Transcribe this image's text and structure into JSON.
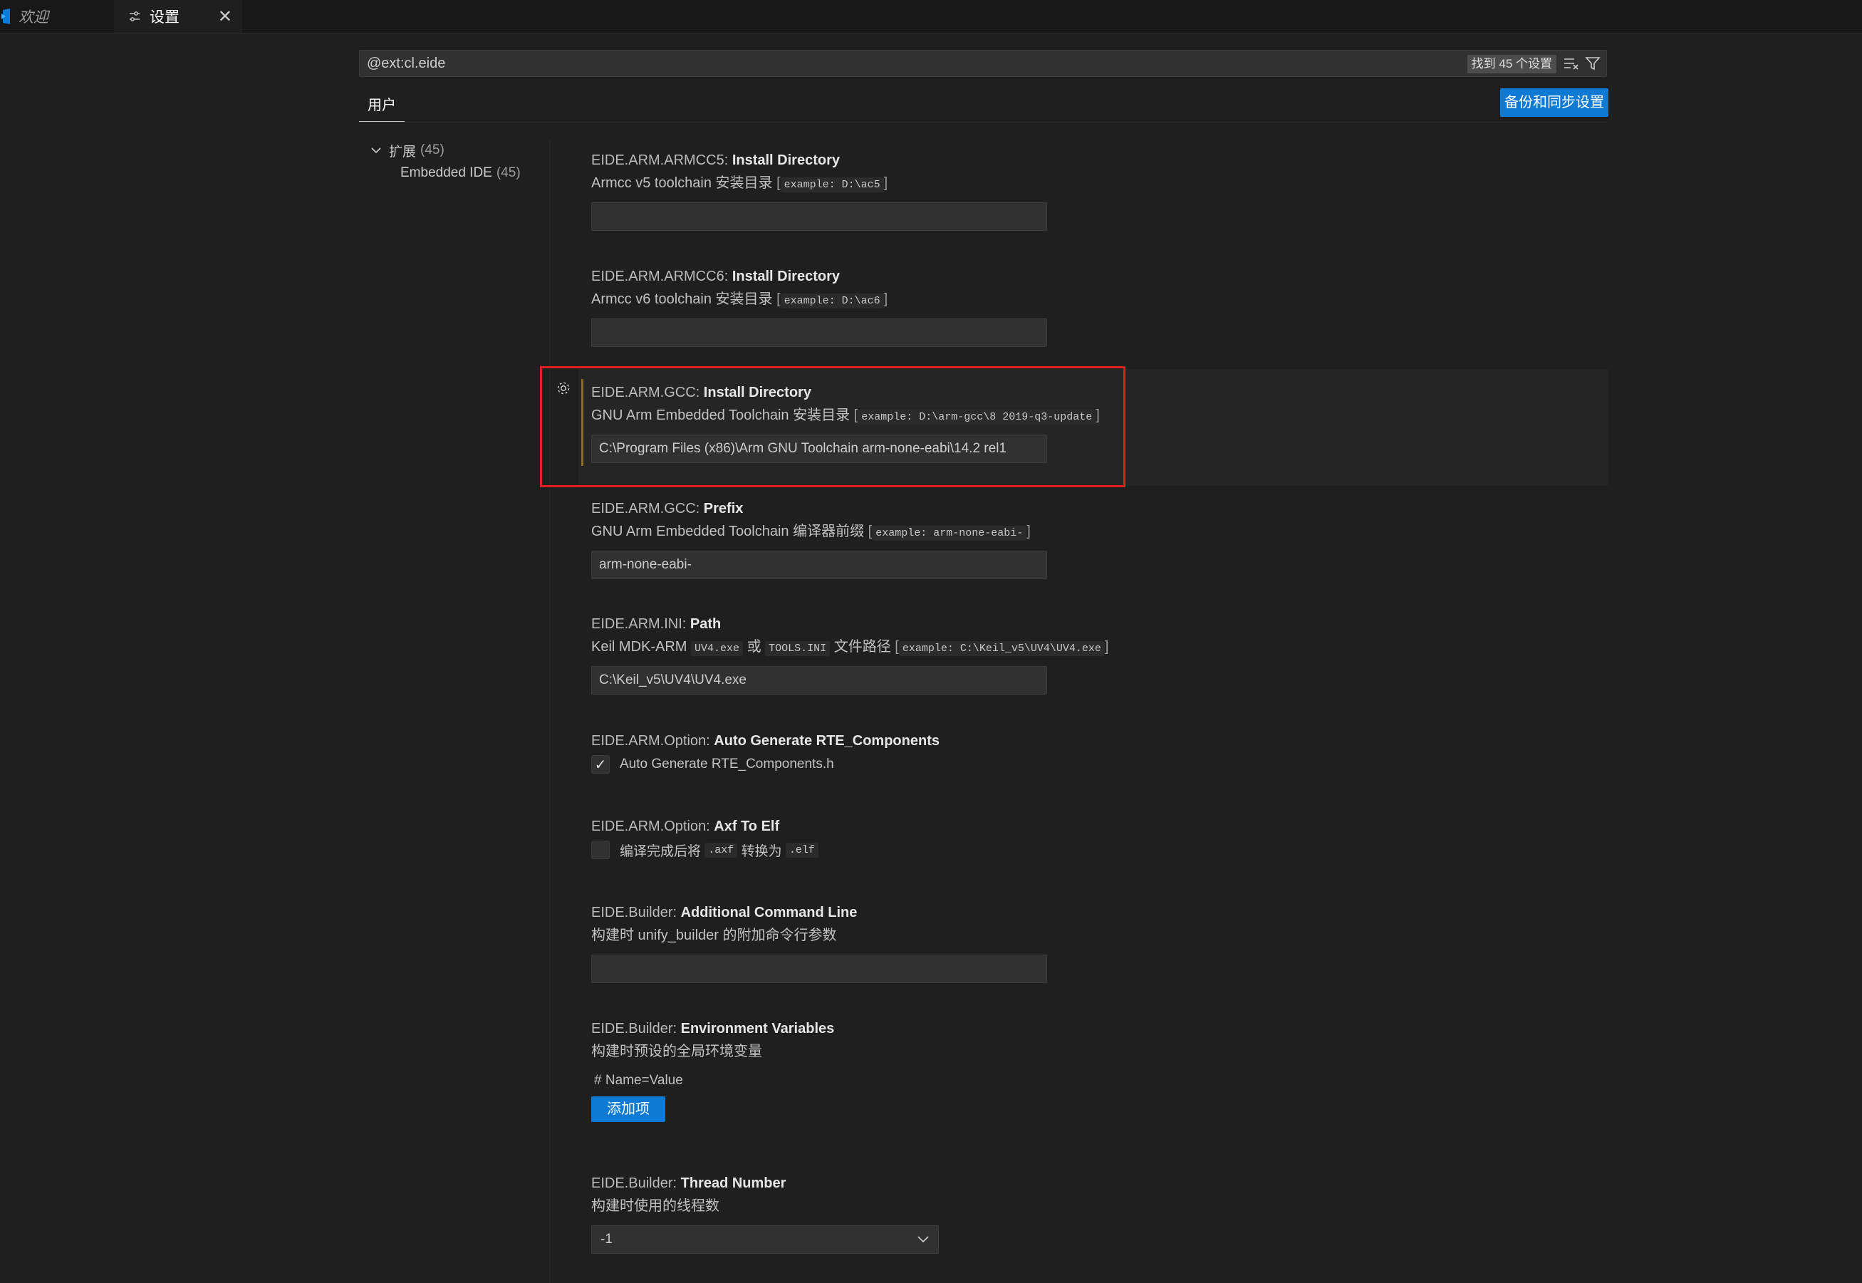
{
  "tabs": {
    "welcome_label": "欢迎",
    "settings_label": "设置",
    "close_glyph": "✕"
  },
  "search": {
    "query": "@ext:cl.eide",
    "result_count": "找到 45 个设置"
  },
  "scope": {
    "user_tab": "用户",
    "sync_button": "备份和同步设置"
  },
  "toc": {
    "group_label": "扩展",
    "group_count": "(45)",
    "item_label": "Embedded IDE",
    "item_count": "(45)"
  },
  "settings": [
    {
      "category": "EIDE.ARM.ARMCC5: ",
      "name": "Install Directory",
      "desc": "Armcc v5 toolchain 安装目录",
      "bracket_open": "[",
      "example": "example: D:\\ac5",
      "bracket_close": "]",
      "value": ""
    },
    {
      "category": "EIDE.ARM.ARMCC6: ",
      "name": "Install Directory",
      "desc": "Armcc v6 toolchain 安装目录",
      "bracket_open": "[",
      "example": "example: D:\\ac6",
      "bracket_close": "]",
      "value": ""
    },
    {
      "category": "EIDE.ARM.GCC: ",
      "name": "Install Directory",
      "desc": "GNU Arm Embedded Toolchain 安装目录",
      "bracket_open": "[",
      "example": "example: D:\\arm-gcc\\8 2019-q3-update",
      "bracket_close": "]",
      "value": "C:\\Program Files (x86)\\Arm GNU Toolchain arm-none-eabi\\14.2 rel1"
    },
    {
      "category": "EIDE.ARM.GCC: ",
      "name": "Prefix",
      "desc": "GNU Arm Embedded Toolchain 编译器前缀",
      "bracket_open": "[",
      "example": "example: arm-none-eabi-",
      "bracket_close": "]",
      "value": "arm-none-eabi-"
    },
    {
      "category": "EIDE.ARM.INI: ",
      "name": "Path",
      "desc_part1": "Keil MDK-ARM",
      "code1": "UV4.exe",
      "desc_part2": "或",
      "code2": "TOOLS.INI",
      "desc_part3": "文件路径",
      "bracket_open": "[",
      "example": "example: C:\\Keil_v5\\UV4\\UV4.exe",
      "bracket_close": "]",
      "value": "C:\\Keil_v5\\UV4\\UV4.exe"
    },
    {
      "category": "EIDE.ARM.Option: ",
      "name": "Auto Generate RTE_Components",
      "checkbox_label": "Auto Generate RTE_Components.h",
      "checked": true,
      "check_glyph": "✓"
    },
    {
      "category": "EIDE.ARM.Option: ",
      "name": "Axf To Elf",
      "label_part1": "编译完成后将",
      "code1": ".axf",
      "label_part2": "转换为",
      "code2": ".elf",
      "checked": false
    },
    {
      "category": "EIDE.Builder: ",
      "name": "Additional Command Line",
      "desc": "构建时 unify_builder 的附加命令行参数",
      "value": ""
    },
    {
      "category": "EIDE.Builder: ",
      "name": "Environment Variables",
      "desc": "构建时预设的全局环境变量",
      "hint": "# Name=Value",
      "add_button": "添加项"
    },
    {
      "category": "EIDE.Builder: ",
      "name": "Thread Number",
      "desc": "构建时使用的线程数",
      "selected": "-1"
    }
  ],
  "colors": {
    "background": "#1f1f1f",
    "accent_button": "#0e7ad3",
    "highlight_box": "#e02020",
    "modified_bar": "#8a6d2b"
  },
  "icons": [
    "vscode-logo-icon",
    "settings-icon",
    "close-icon",
    "clear-filter-icon",
    "filter-icon",
    "chevron-down-icon",
    "gear-icon",
    "check-icon"
  ]
}
